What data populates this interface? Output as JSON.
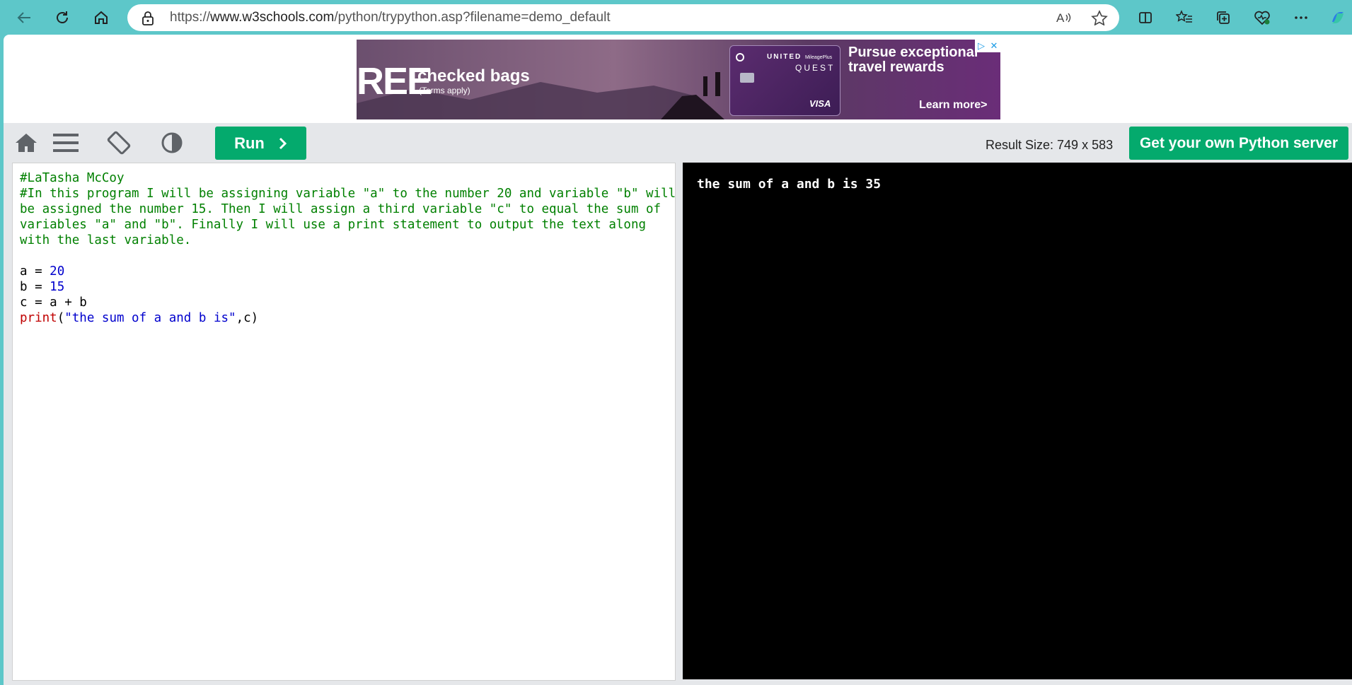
{
  "browser": {
    "url_prefix": "https://",
    "url_host": "www.w3schools.com",
    "url_path": "/python/trypython.asp?filename=demo_default",
    "icons": [
      "back-icon",
      "refresh-icon",
      "home-icon",
      "lock-icon",
      "read-aloud-icon",
      "favorite-star-icon",
      "split-screen-icon",
      "favorites-icon",
      "collections-icon",
      "browser-essentials-icon",
      "more-icon",
      "copilot-icon"
    ]
  },
  "ad": {
    "free_text": "REE",
    "checked_bags": "checked bags",
    "terms": "(Terms apply)",
    "card_brand": "UNITED",
    "card_sub": "MileagePlus",
    "card_name": "QUEST",
    "card_network": "VISA",
    "headline": "Pursue exceptional travel rewards",
    "cta": "Learn more>"
  },
  "toolbar": {
    "run_label": "Run",
    "result_size_label": "Result Size: 749 x 583",
    "get_server_label": "Get your own Python server",
    "accent": "#04aa6d"
  },
  "editor": {
    "comment_author": "#LaTasha McCoy",
    "comment_lines": [
      "#In this program I will be assigning variable \"a\" to the number 20 and variable \"b\" will",
      "be assigned the number 15. Then I will assign a third variable \"c\" to equal the sum of",
      "variables \"a\" and \"b\". Finally I will use a print statement to output the text along",
      "with the last variable."
    ],
    "line_a_var": "a = ",
    "line_a_val": "20",
    "line_b_var": "b = ",
    "line_b_val": "15",
    "line_c": "c = a + b",
    "print_kw": "print",
    "print_open": "(",
    "print_str": "\"the sum of a and b is\"",
    "print_rest": ",c)"
  },
  "result": {
    "output": "the sum of a and b is 35"
  }
}
